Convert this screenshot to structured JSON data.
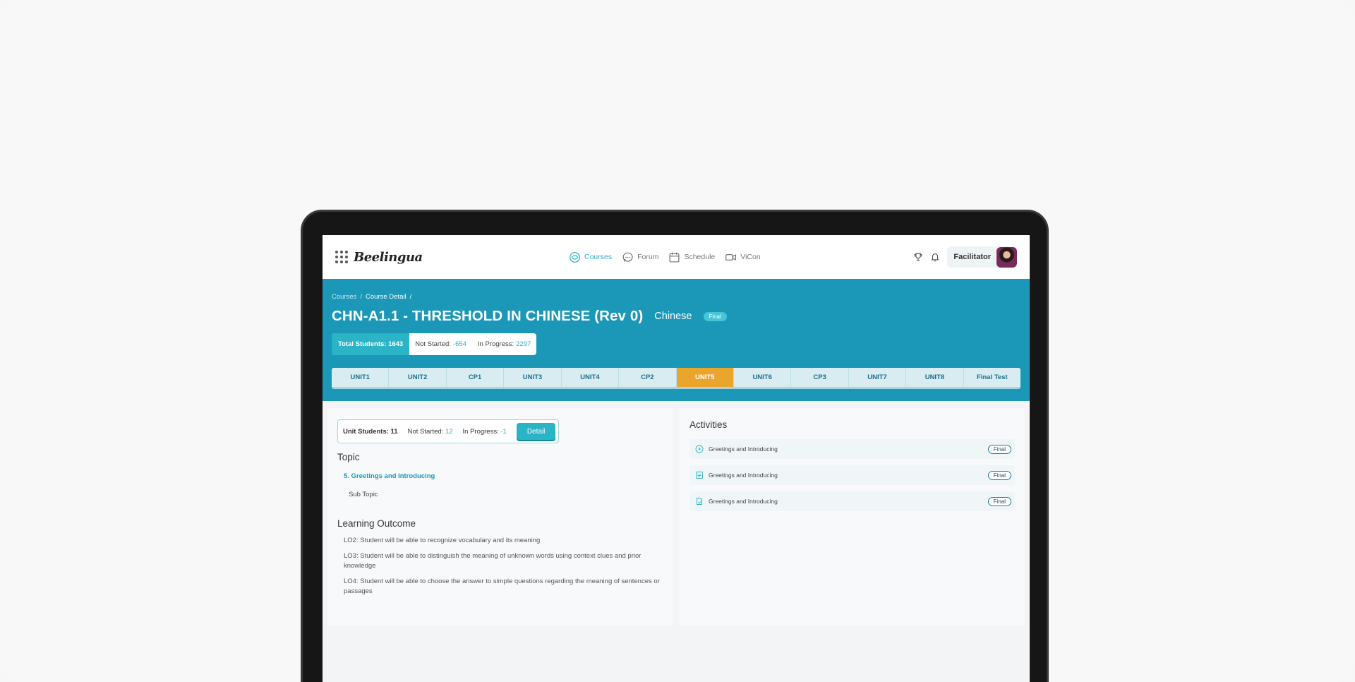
{
  "app": {
    "logo": "Beelingua"
  },
  "nav": {
    "items": [
      {
        "label": "Courses",
        "icon": "courses-icon"
      },
      {
        "label": "Forum",
        "icon": "forum-icon"
      },
      {
        "label": "Schedule",
        "icon": "calendar-icon"
      },
      {
        "label": "ViCon",
        "icon": "video-icon"
      }
    ],
    "active": "Courses",
    "user_role": "Facilitator"
  },
  "breadcrumb": {
    "items": [
      "Courses",
      "Course Detail"
    ],
    "separator": "/"
  },
  "course": {
    "title": "CHN-A1.1 - THRESHOLD IN CHINESE (Rev 0)",
    "language": "Chinese",
    "status": "Final"
  },
  "course_stats": {
    "total_label": "Total Students: 1643",
    "not_started_label": "Not Started:",
    "not_started_value": "-654",
    "in_progress_label": "In Progress:",
    "in_progress_value": "2297"
  },
  "unit_tabs": {
    "items": [
      "UNIT1",
      "UNIT2",
      "CP1",
      "UNIT3",
      "UNIT4",
      "CP2",
      "UNIT5",
      "UNIT6",
      "CP3",
      "UNIT7",
      "UNIT8",
      "Final Test"
    ],
    "active": "UNIT5"
  },
  "unit_stats": {
    "students_label": "Unit Students: 11",
    "not_started_label": "Not Started:",
    "not_started_value": "12",
    "in_progress_label": "In Progress:",
    "in_progress_value": "-1",
    "detail_button": "Detail"
  },
  "topic": {
    "heading": "Topic",
    "title": "5. Greetings and Introducing",
    "sub_topic": "Sub Topic"
  },
  "learning_outcome": {
    "heading": "Learning Outcome",
    "items": [
      "LO2: Student will be able to recognize vocabulary and its meaning",
      "LO3: Student will be able to distinguish the meaning of unknown words using context clues and prior knowledge",
      "LO4: Student will be able to choose the answer to simple questions regarding the meaning of sentences or passages"
    ]
  },
  "activities": {
    "heading": "Activities",
    "items": [
      {
        "label": "Greetings and Introducing",
        "status": "Final",
        "icon": "play-circle-icon"
      },
      {
        "label": "Greetings and Introducing",
        "status": "Final",
        "icon": "list-icon"
      },
      {
        "label": "Greetings and Introducing",
        "status": "Final",
        "icon": "document-icon"
      }
    ]
  },
  "colors": {
    "primary": "#1b97b8",
    "accent": "#2bb3c6",
    "active_tab": "#e9a52c"
  }
}
